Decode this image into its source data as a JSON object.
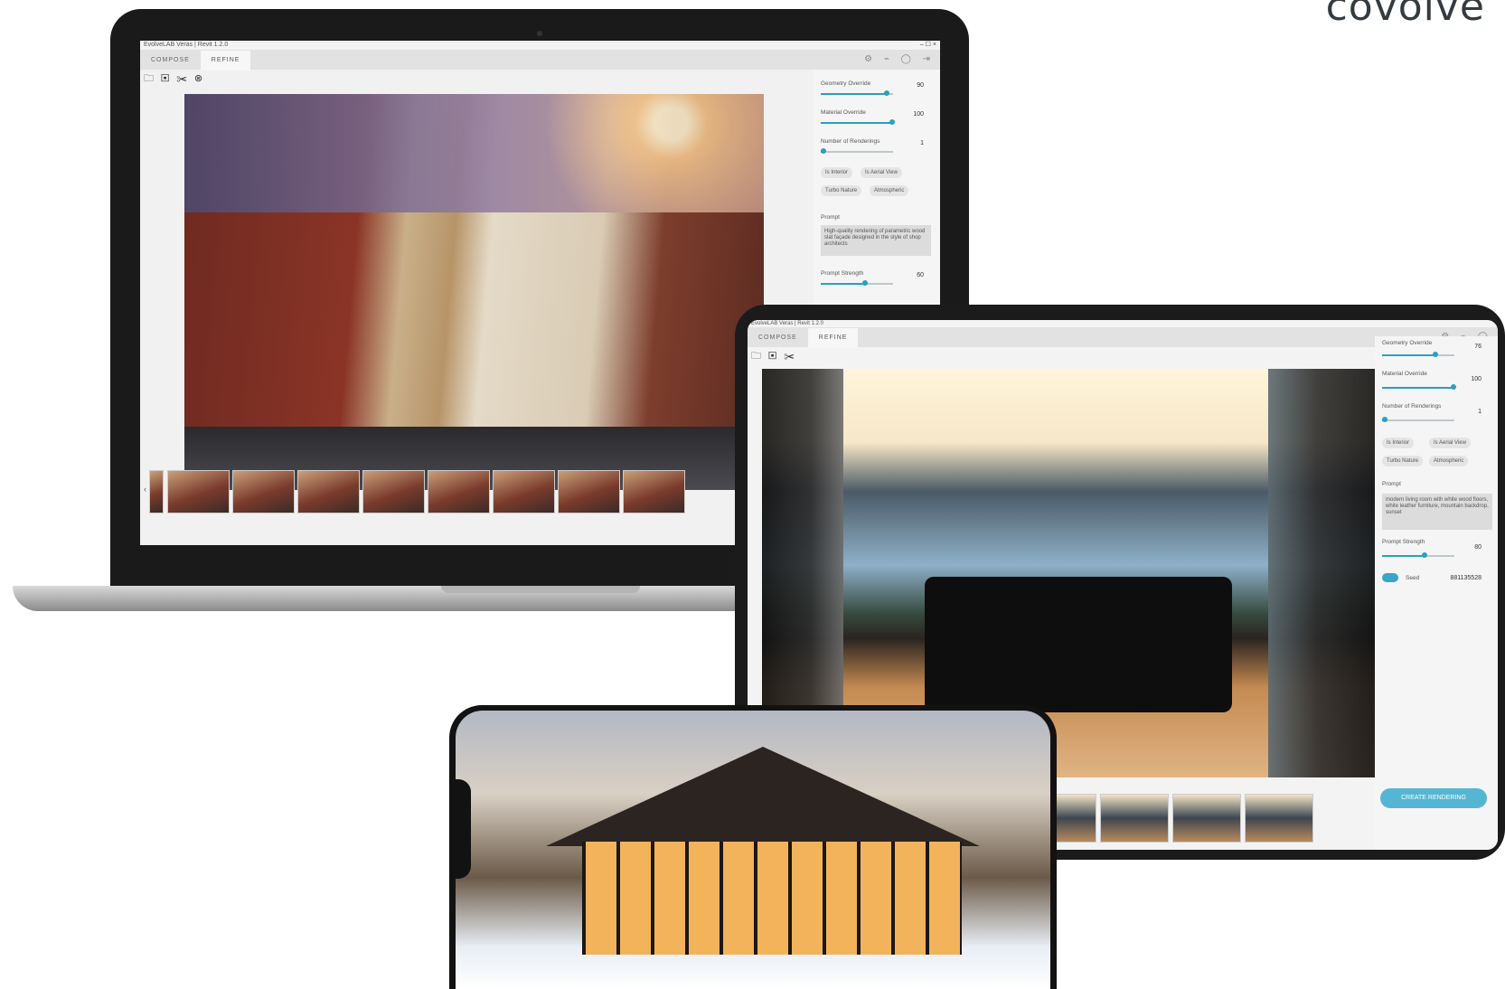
{
  "brand": "covolve",
  "laptop": {
    "title": "EvolveLAB Veras | Revit 1.2.0",
    "window_controls": "– ☐ ×",
    "tabs": [
      "COMPOSE",
      "REFINE"
    ],
    "active_tab": "REFINE",
    "toolbar_icons": [
      "folder-icon",
      "save-icon",
      "magic-icon",
      "close-circle-icon"
    ],
    "sidebar": {
      "geometry_override": {
        "label": "Geometry Override",
        "value": "90"
      },
      "material_override": {
        "label": "Material Override",
        "value": "100"
      },
      "renderings": {
        "label": "Number of Renderings",
        "value": "1"
      },
      "chips": [
        "Is Interior",
        "Is Aerial View",
        "Turbo Nature",
        "Atmospheric"
      ],
      "prompt_label": "Prompt",
      "prompt_text": "High-quality rendering of parametric wood slat façade designed in the style of shop architects",
      "prompt_strength": {
        "label": "Prompt Strength",
        "value": "60"
      }
    },
    "thumbnail_count": 9
  },
  "tablet": {
    "title": "EvolveLAB Veras | Revit 1.2.0",
    "tabs": [
      "COMPOSE",
      "REFINE"
    ],
    "active_tab": "REFINE",
    "sidebar": {
      "geometry_override": {
        "label": "Geometry Override",
        "value": "76"
      },
      "material_override": {
        "label": "Material Override",
        "value": "100"
      },
      "renderings": {
        "label": "Number of Renderings",
        "value": "1"
      },
      "chips": [
        "Is Interior",
        "Is Aerial View",
        "Turbo Nature",
        "Atmospheric"
      ],
      "prompt_label": "Prompt",
      "prompt_text": "modern living room with white wood floors, white leather furniture, mountain backdrop, sunset",
      "prompt_strength": {
        "label": "Prompt Strength",
        "value": "80"
      },
      "seed_label": "Seed",
      "seed_value": "881135528",
      "create_button": "CREATE RENDERING"
    },
    "thumbnail_count": 4
  }
}
